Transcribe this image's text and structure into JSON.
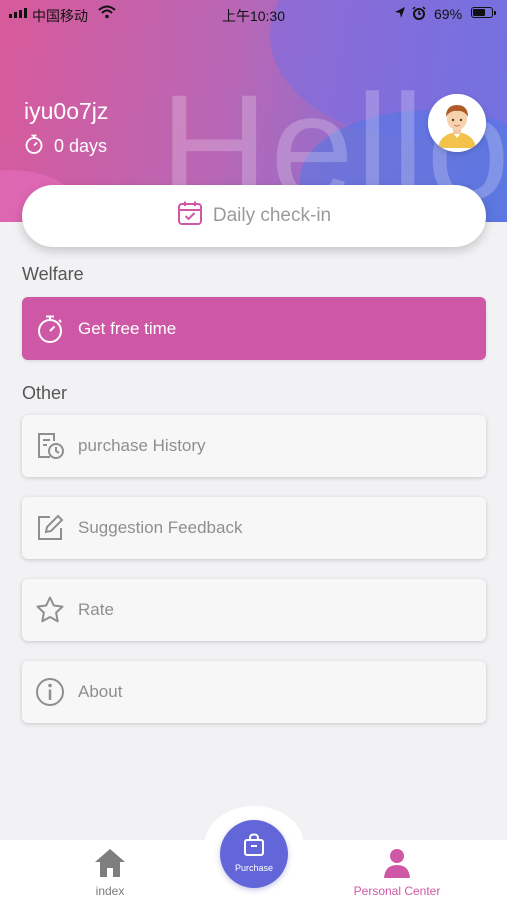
{
  "status_bar": {
    "carrier": "中国移动",
    "time": "上午10:30",
    "battery_text": "69%",
    "battery_level": 0.69,
    "icons": [
      "signal-icon",
      "wifi-icon",
      "location-icon",
      "alarm-icon",
      "battery-icon"
    ]
  },
  "header": {
    "background_text": "Hello",
    "username": "iyu0o7jz",
    "days_text": "0 days",
    "colors": {
      "gradient_start": "#d85a9a",
      "gradient_end": "#6a76dc"
    }
  },
  "checkin": {
    "label": "Daily check-in",
    "icon": "calendar-check-icon"
  },
  "welfare": {
    "title": "Welfare",
    "item": {
      "label": "Get free time",
      "icon": "stopwatch-icon",
      "color": "#cf58a6"
    }
  },
  "other": {
    "title": "Other",
    "items": [
      {
        "label": "purchase History",
        "icon": "history-document-icon"
      },
      {
        "label": "Suggestion Feedback",
        "icon": "edit-icon"
      },
      {
        "label": "Rate",
        "icon": "star-icon"
      },
      {
        "label": "About",
        "icon": "info-icon"
      }
    ]
  },
  "bottom_nav": {
    "index_label": "index",
    "purchase_label": "Purchase",
    "personal_label": "Personal Center",
    "active_color": "#cf58a6",
    "purchase_color": "#6366d8"
  }
}
